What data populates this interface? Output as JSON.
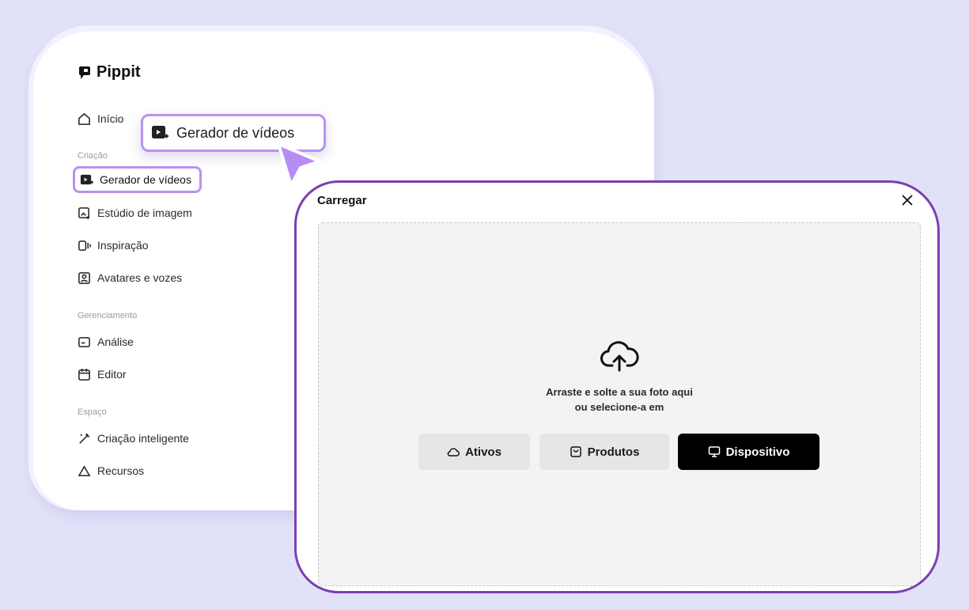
{
  "brand": {
    "name": "Pippit"
  },
  "sidebar": {
    "home": "Início",
    "sections": {
      "creation": "Criação",
      "management": "Gerenciamento",
      "space": "Espaço"
    },
    "items": {
      "video_generator": "Gerador de vídeos",
      "image_studio": "Estúdio de imagem",
      "inspiration": "Inspiração",
      "avatars": "Avatares e vozes",
      "analytics": "Análise",
      "editor": "Editor",
      "smart_creation": "Criação inteligente",
      "resources": "Recursos"
    }
  },
  "callout": {
    "label": "Gerador de vídeos"
  },
  "modal": {
    "title": "Carregar",
    "drop_line1": "Arraste e solte a sua foto aqui",
    "drop_line2": "ou selecione-a em",
    "buttons": {
      "assets": "Ativos",
      "products": "Produtos",
      "device": "Dispositivo"
    }
  },
  "colors": {
    "background": "#e1e1f8",
    "highlight": "#b892f2",
    "modal_border": "#7b3fb3",
    "cursor": "#b88cf5"
  },
  "icons": [
    "pippit-logo-icon",
    "home-icon",
    "video-generator-icon",
    "image-studio-icon",
    "inspiration-icon",
    "avatar-icon",
    "analytics-icon",
    "calendar-icon",
    "magic-wand-icon",
    "resources-icon",
    "cursor-arrow-icon",
    "close-icon",
    "cloud-upload-icon",
    "cloud-icon",
    "bag-icon",
    "monitor-icon"
  ]
}
